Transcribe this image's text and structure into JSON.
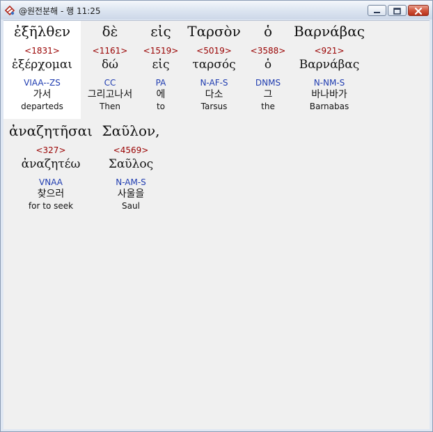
{
  "window": {
    "title": "@원전분해 - 행 11:25",
    "icon": "app-icon",
    "controls": [
      "minimize-icon",
      "maximize-icon",
      "close-icon"
    ]
  },
  "words": [
    {
      "greek": "ἐξῆλθεν",
      "strong": "<1831>",
      "lemma": "ἐξέρχομαι",
      "morph": "VIAA--ZS",
      "korean": "가서",
      "english": "departeds"
    },
    {
      "greek": "δὲ",
      "strong": "<1161>",
      "lemma": "δώ",
      "morph": "CC",
      "korean": "그리고나서",
      "english": "Then"
    },
    {
      "greek": "εἰς",
      "strong": "<1519>",
      "lemma": "εἰς",
      "morph": "PA",
      "korean": "에",
      "english": "to"
    },
    {
      "greek": "Ταρσὸν",
      "strong": "<5019>",
      "lemma": "ταρσός",
      "morph": "N-AF-S",
      "korean": "다소",
      "english": "Tarsus"
    },
    {
      "greek": "ὁ",
      "strong": "<3588>",
      "lemma": "ὁ",
      "morph": "DNMS",
      "korean": "그",
      "english": "the"
    },
    {
      "greek": "Βαρνάβας",
      "strong": "<921>",
      "lemma": "Βαρνάβας",
      "morph": "N-NM-S",
      "korean": "바나바가",
      "english": "Barnabas"
    },
    {
      "greek": "ἀναζητῆσαι",
      "strong": "<327>",
      "lemma": "ἀναζητέω",
      "morph": "VNAA",
      "korean": "찾으러",
      "english": "for to seek"
    },
    {
      "greek": "Σαῦλον,",
      "strong": "<4569>",
      "lemma": "Σαῦλος",
      "morph": "N-AM-S",
      "korean": "사울을",
      "english": "Saul"
    }
  ]
}
